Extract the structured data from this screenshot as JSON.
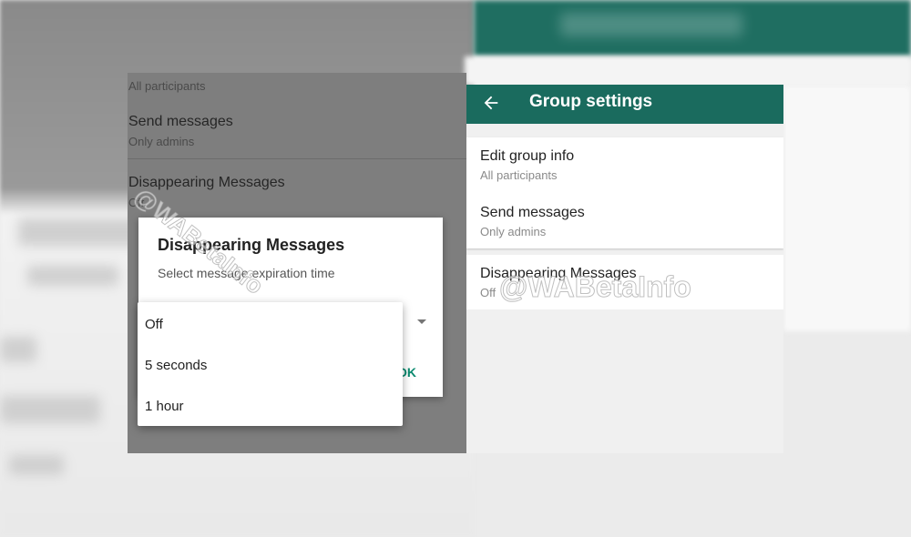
{
  "left_screen": {
    "rows": [
      {
        "title": "",
        "subtitle": "All participants"
      },
      {
        "title": "Send messages",
        "subtitle": "Only admins"
      },
      {
        "title": "Disappearing Messages",
        "subtitle": "Off"
      }
    ]
  },
  "dialog": {
    "title": "Disappearing Messages",
    "subtitle": "Select message expiration time",
    "ok_label": "OK",
    "options": [
      "Off",
      "5 seconds",
      "1 hour"
    ]
  },
  "right_screen": {
    "title": "Group settings",
    "rows": [
      {
        "title": "Edit group info",
        "subtitle": "All participants"
      },
      {
        "title": "Send messages",
        "subtitle": "Only admins"
      },
      {
        "title": "Disappearing Messages",
        "subtitle": "Off"
      }
    ]
  },
  "watermark": "@WABetaInfo",
  "colors": {
    "accent": "#1a6b5e",
    "ok_button": "#0b8a6f"
  }
}
